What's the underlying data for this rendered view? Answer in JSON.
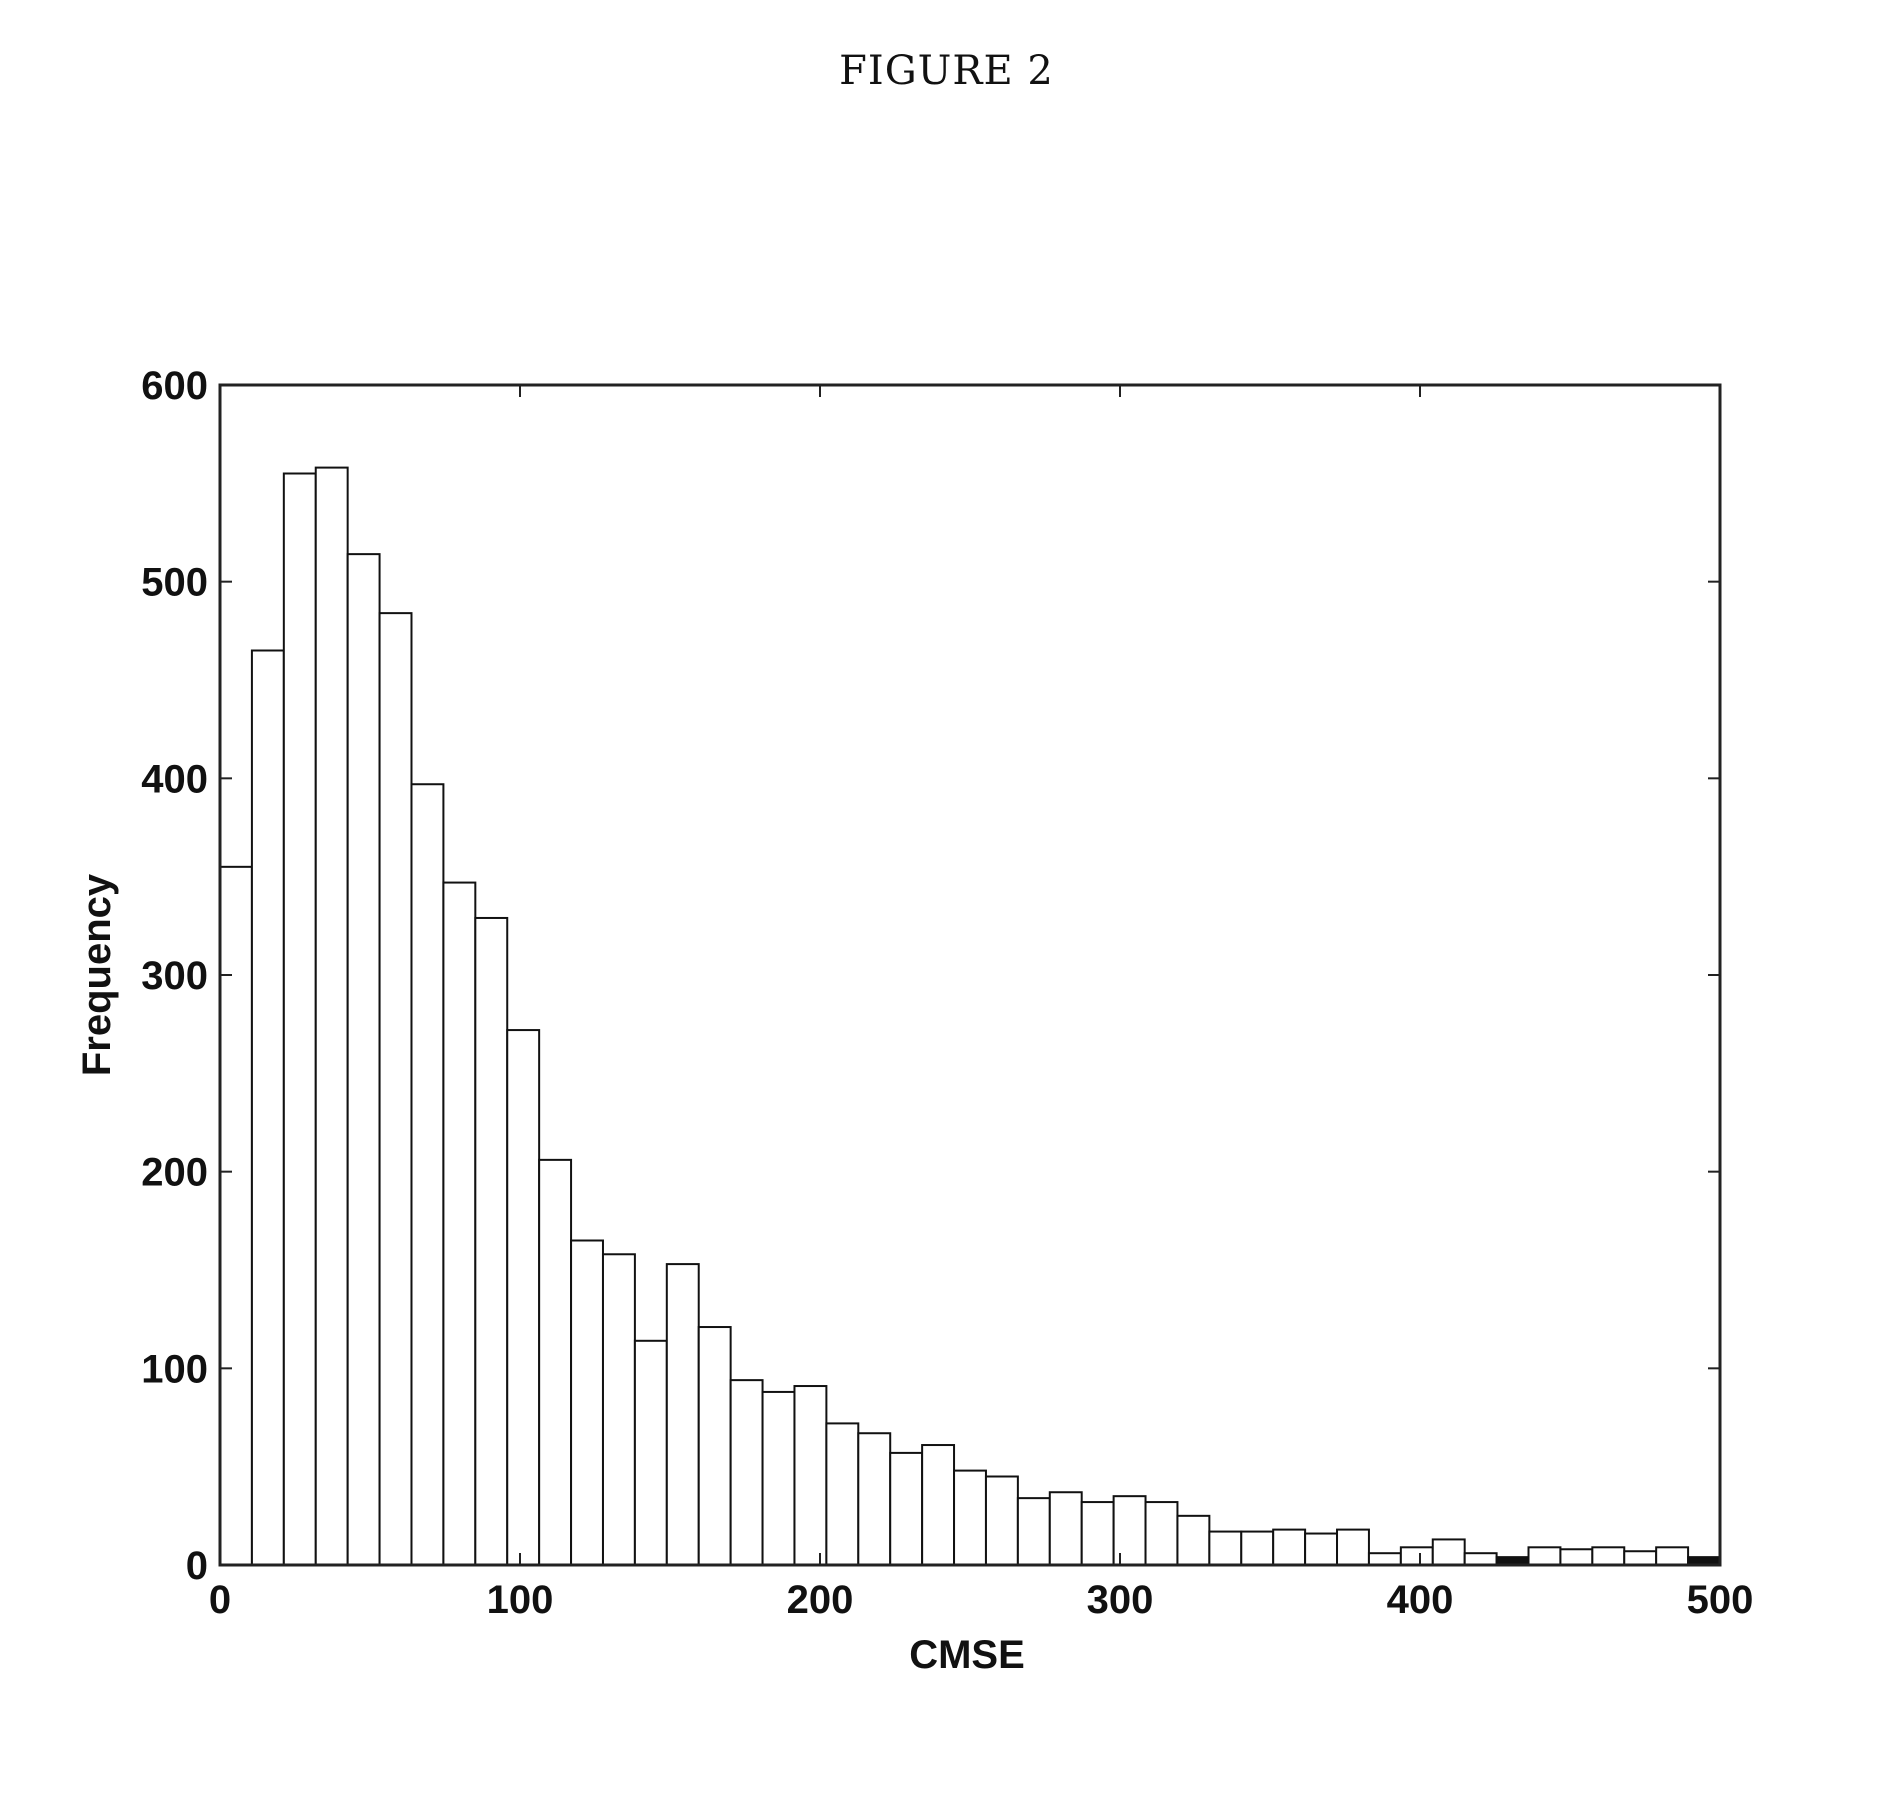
{
  "figure_label": "FIGURE 2",
  "chart_data": {
    "type": "bar",
    "subtype": "histogram",
    "title": "",
    "xlabel": "CMSE",
    "ylabel": "Frequency",
    "xlim": [
      0,
      500
    ],
    "ylim": [
      0,
      600
    ],
    "xticks": [
      0,
      100,
      200,
      300,
      400,
      500
    ],
    "yticks": [
      0,
      100,
      200,
      300,
      400,
      500,
      600
    ],
    "grid": false,
    "legend": "none",
    "bin_count": 47,
    "bin_range": [
      0,
      500
    ],
    "values": [
      355,
      465,
      555,
      558,
      514,
      484,
      397,
      347,
      329,
      272,
      206,
      165,
      158,
      114,
      153,
      121,
      94,
      88,
      91,
      72,
      67,
      57,
      61,
      48,
      45,
      34,
      37,
      32,
      35,
      32,
      25,
      17,
      17,
      18,
      16,
      18,
      6,
      9,
      13,
      6,
      4,
      9,
      8,
      9,
      7,
      9,
      4
    ],
    "bar_fill": "#ffffff",
    "bar_edge": "#111111"
  }
}
